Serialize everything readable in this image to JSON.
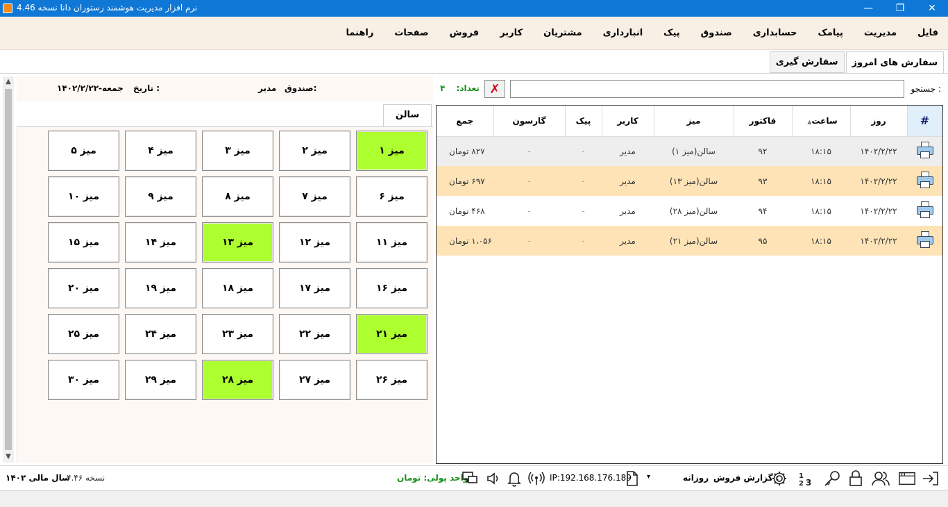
{
  "window": {
    "title": "نرم افزار مدیریت هوشمند رستوران دانا نسخه  4.46",
    "minimize_glyph": "—",
    "restore_glyph": "❐",
    "close_glyph": "✕"
  },
  "menu": [
    "فایل",
    "مدیریت",
    "پیامک",
    "حسابداری",
    "صندوق",
    "پیک",
    "انبارداری",
    "مشتریان",
    "کاربر",
    "فروش",
    "صفحات",
    "راهنما"
  ],
  "tabs": {
    "today_orders": "سفارش های امروز",
    "order_taking": "سفارش گیری"
  },
  "left_header": {
    "date_label": "تاریخ :",
    "date_value": "۱۴۰۲/۲/۲۲-جمعه",
    "cashbox_label": "صندوق:",
    "cashbox_value": "مدیر"
  },
  "saloon": {
    "tab_label": "سالن",
    "tables": [
      {
        "label": "میز ۱",
        "busy": true
      },
      {
        "label": "میز ۲",
        "busy": false
      },
      {
        "label": "میز ۳",
        "busy": false
      },
      {
        "label": "میز ۴",
        "busy": false
      },
      {
        "label": "میز ۵",
        "busy": false
      },
      {
        "label": "میز ۶",
        "busy": false
      },
      {
        "label": "میز ۷",
        "busy": false
      },
      {
        "label": "میز ۸",
        "busy": false
      },
      {
        "label": "میز ۹",
        "busy": false
      },
      {
        "label": "میز ۱۰",
        "busy": false
      },
      {
        "label": "میز ۱۱",
        "busy": false
      },
      {
        "label": "میز ۱۲",
        "busy": false
      },
      {
        "label": "میز ۱۳",
        "busy": true
      },
      {
        "label": "میز ۱۴",
        "busy": false
      },
      {
        "label": "میز ۱۵",
        "busy": false
      },
      {
        "label": "میز ۱۶",
        "busy": false
      },
      {
        "label": "میز ۱۷",
        "busy": false
      },
      {
        "label": "میز ۱۸",
        "busy": false
      },
      {
        "label": "میز ۱۹",
        "busy": false
      },
      {
        "label": "میز ۲۰",
        "busy": false
      },
      {
        "label": "میز ۲۱",
        "busy": true
      },
      {
        "label": "میز ۲۲",
        "busy": false
      },
      {
        "label": "میز ۲۳",
        "busy": false
      },
      {
        "label": "میز ۲۴",
        "busy": false
      },
      {
        "label": "میز ۲۵",
        "busy": false
      },
      {
        "label": "میز ۲۶",
        "busy": false
      },
      {
        "label": "میز ۲۷",
        "busy": false
      },
      {
        "label": "میز ۲۸",
        "busy": true
      },
      {
        "label": "میز ۲۹",
        "busy": false
      },
      {
        "label": "میز ۳۰",
        "busy": false
      }
    ]
  },
  "search": {
    "label": "جستجو :",
    "value": "",
    "clear_glyph": "✗",
    "count_label": "تعداد:",
    "count_value": "۴"
  },
  "orders": {
    "columns": {
      "hash": "#",
      "day": "روز",
      "time": "ساعت",
      "invoice": "فاکتور",
      "table": "میز",
      "user": "کاربر",
      "courier": "پیک",
      "waiter": "گارسون",
      "total": "جمع"
    },
    "sort_glyph": "▲",
    "rows": [
      {
        "day": "۱۴۰۲/۲/۲۲",
        "time": "۱۸:۱۵",
        "invoice": "۹۲",
        "table": "سالن(میز ۱)",
        "user": "مدیر",
        "courier": "-",
        "waiter": "-",
        "total": "۸۲۷ تومان"
      },
      {
        "day": "۱۴۰۲/۲/۲۲",
        "time": "۱۸:۱۵",
        "invoice": "۹۳",
        "table": "سالن(میز ۱۳)",
        "user": "مدیر",
        "courier": "-",
        "waiter": "-",
        "total": "۶۹۷ تومان"
      },
      {
        "day": "۱۴۰۲/۲/۲۲",
        "time": "۱۸:۱۵",
        "invoice": "۹۴",
        "table": "سالن(میز ۲۸)",
        "user": "مدیر",
        "courier": "-",
        "waiter": "-",
        "total": "۴۶۸ تومان"
      },
      {
        "day": "۱۴۰۲/۲/۲۲",
        "time": "۱۸:۱۵",
        "invoice": "۹۵",
        "table": "سالن(میز ۲۱)",
        "user": "مدیر",
        "courier": "-",
        "waiter": "-",
        "total": "۱،۰۵۶ تومان"
      }
    ]
  },
  "status": {
    "fiscal_year": "سال مالی ۱۴۰۲",
    "version": "نسخه  ۴.۴۶",
    "currency": "واحد پولی: تومان",
    "ip": "IP:192.168.176.189",
    "sales_report_label": "گزارش فروش :",
    "sales_report_value": "روزانه",
    "dropdown_glyph": "▾"
  },
  "colors": {
    "titlebar": "#0f78d7",
    "busy_table": "#adff2f",
    "alt_row": "#fde3b6",
    "count_green": "#1a8f1a"
  }
}
